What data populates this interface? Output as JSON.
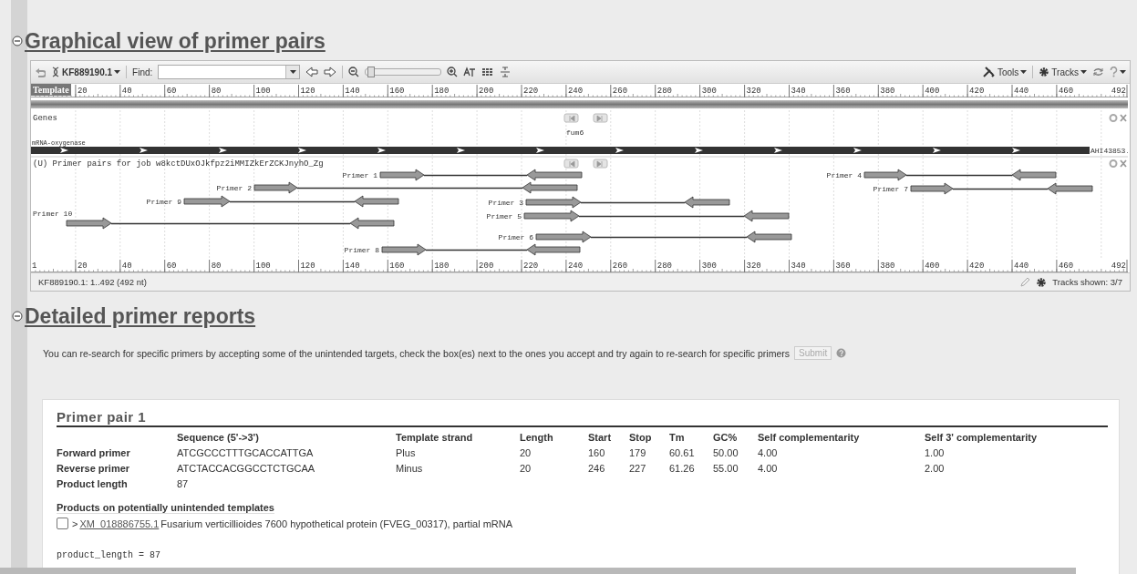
{
  "viewer_section": {
    "title": "Graphical view of primer pairs",
    "expanded": true
  },
  "toolbar": {
    "sequence": "KF889190.1",
    "find_label": "Find:",
    "zoom": {
      "level": 0.02
    },
    "tools": "Tools",
    "tracks": "Tracks"
  },
  "top_ruler": {
    "start_label": "Template",
    "ticks": [
      "20",
      "40",
      "60",
      "80",
      "100",
      "120",
      "140",
      "160",
      "180",
      "200",
      "220",
      "240",
      "260",
      "280",
      "300",
      "320",
      "340",
      "360",
      "380",
      "400",
      "420",
      "440",
      "460"
    ],
    "end_label": "492"
  },
  "genes_track": {
    "title": "Genes",
    "gene_label": "fum6",
    "feature_label": "mRNA-oxygenase",
    "feature_end_label": "AHI43853."
  },
  "primer_track": {
    "title": "(U) Primer pairs for job w8kctDUxOJkfpz2iMMIZkErZCKJnyhO_Zg",
    "pairs": [
      {
        "label": "Primer 1"
      },
      {
        "label": "Primer 2"
      },
      {
        "label": "Primer 3"
      },
      {
        "label": "Primer 4"
      },
      {
        "label": "Primer 5"
      },
      {
        "label": "Primer 6"
      },
      {
        "label": "Primer 7"
      },
      {
        "label": "Primer 8"
      },
      {
        "label": "Primer 9"
      },
      {
        "label": "Primer 10"
      }
    ]
  },
  "bottom_ruler": {
    "start_label": "1",
    "ticks": [
      "20",
      "40",
      "60",
      "80",
      "100",
      "120",
      "140",
      "160",
      "180",
      "200",
      "220",
      "240",
      "260",
      "280",
      "300",
      "320",
      "340",
      "360",
      "380",
      "400",
      "420",
      "440",
      "460"
    ],
    "end_label": "492"
  },
  "status_bar": {
    "location": "KF889190.1: 1..492 (492 nt)",
    "tracks_shown": "Tracks shown: 3/7"
  },
  "report_section": {
    "title": "Detailed primer reports",
    "expanded": true
  },
  "instructions": "You can re-search for specific primers by accepting some of the unintended targets, check the box(es) next to the ones you accept and try again to re-search for specific primers",
  "submit": {
    "label": "Submit",
    "disabled": true
  },
  "primer_pair": {
    "title": "Primer pair 1",
    "columns": [
      "",
      "Sequence (5'->3')",
      "Template strand",
      "Length",
      "Start",
      "Stop",
      "Tm",
      "GC%",
      "Self complementarity",
      "Self 3' complementarity"
    ],
    "rows": [
      [
        "Forward primer",
        "ATCGCCCTTTGCACCATTGA",
        "Plus",
        "20",
        "160",
        "179",
        "60.61",
        "50.00",
        "4.00",
        "1.00"
      ],
      [
        "Reverse primer",
        "ATCTACCACGGCCTCTGCAA",
        "Minus",
        "20",
        "246",
        "227",
        "61.26",
        "55.00",
        "4.00",
        "2.00"
      ],
      [
        "Product length",
        "87"
      ]
    ],
    "unintended": {
      "title": "Products on potentially unintended templates",
      "items": [
        {
          "checked": false,
          "prefix": ">",
          "accession": "XM_018886755.1",
          "description": "Fusarium verticillioides 7600 hypothetical protein (FVEG_00317), partial mRNA"
        }
      ]
    },
    "footer": "product_length = 87"
  }
}
